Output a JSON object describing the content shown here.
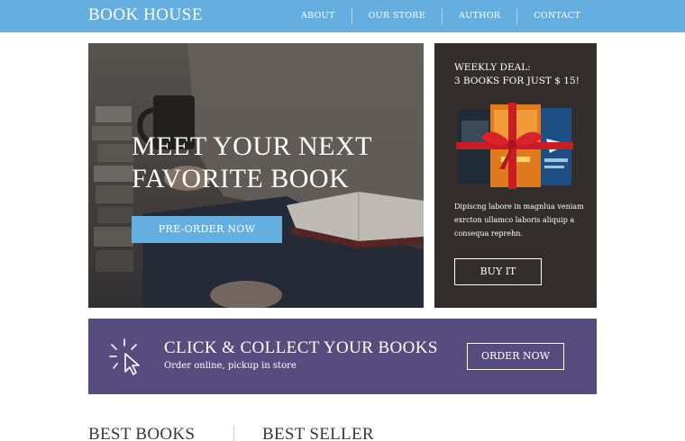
{
  "header": {
    "logo": "BOOK HOUSE",
    "nav": [
      "ABOUT",
      "OUR STORE",
      "AUTHOR",
      "CONTACT"
    ]
  },
  "hero": {
    "title_line1": "MEET YOUR NEXT",
    "title_line2": "FAVORITE BOOK",
    "cta": "PRE-ORDER NOW"
  },
  "deal": {
    "title_line1": "WEEKLY DEAL:",
    "title_line2": "3 BOOKS FOR JUST $ 15!",
    "text_line1": "Dipiscng labore in magnlua veniam",
    "text_line2": "exrcton ullamco laboris aliquip a",
    "text_line3": "consequa reprehn.",
    "button": "BUY IT"
  },
  "banner": {
    "title": "CLICK & COLLECT YOUR BOOKS",
    "subtitle": "Order online, pickup in store",
    "button": "ORDER NOW"
  },
  "sections": {
    "best_books": "BEST BOOKS",
    "best_seller": "BEST SELLER"
  },
  "colors": {
    "header_bg": "#64aee0",
    "deal_bg": "#332e2c",
    "banner_bg": "#564d7e"
  }
}
